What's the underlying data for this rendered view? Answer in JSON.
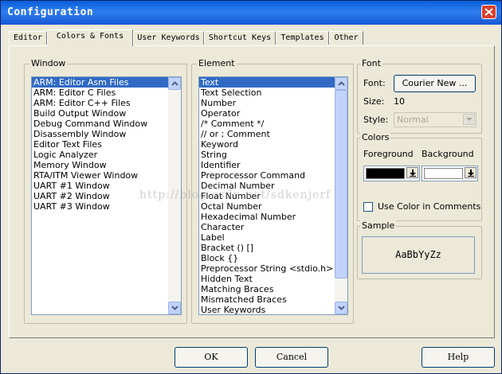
{
  "window": {
    "title": "Configuration"
  },
  "tabs": [
    {
      "label": "Editor",
      "active": false
    },
    {
      "label": "Colors & Fonts",
      "active": true
    },
    {
      "label": "User Keywords",
      "active": false
    },
    {
      "label": "Shortcut Keys",
      "active": false
    },
    {
      "label": "Templates",
      "active": false
    },
    {
      "label": "Other",
      "active": false
    }
  ],
  "window_group": {
    "label": "Window",
    "items": [
      "ARM: Editor Asm Files",
      "ARM: Editor C Files",
      "ARM: Editor C++ Files",
      "Build Output Window",
      "Debug Command Window",
      "Disassembly Window",
      "Editor Text Files",
      "Logic Analyzer",
      "Memory Window",
      "RTA/ITM Viewer Window",
      "UART #1 Window",
      "UART #2 Window",
      "UART #3 Window"
    ],
    "selected": "ARM: Editor Asm Files"
  },
  "element_group": {
    "label": "Element",
    "items": [
      "Text",
      "Text Selection",
      "Number",
      "Operator",
      "/* Comment */",
      "// or ; Comment",
      "Keyword",
      "String",
      "Identifier",
      "Preprocessor Command",
      "Decimal Number",
      "Float Number",
      "Octal Number",
      "Hexadecimal Number",
      "Character",
      "Label",
      "Bracket () []",
      "Block {}",
      "Preprocessor String <stdio.h>",
      "Hidden Text",
      "Matching Braces",
      "Mismatched Braces",
      "User Keywords"
    ],
    "selected": "Text"
  },
  "font_group": {
    "label": "Font",
    "font_label": "Font:",
    "font_button": "Courier New ...",
    "size_label": "Size:",
    "size_value": "10",
    "style_label": "Style:",
    "style_value": "Normal"
  },
  "colors_group": {
    "label": "Colors",
    "foreground_label": "Foreground",
    "background_label": "Background",
    "foreground_color": "#000000",
    "background_color": "#ffffff",
    "use_color_in_comments_label": "Use Color in Comments",
    "use_color_in_comments_checked": false
  },
  "sample_group": {
    "label": "Sample",
    "sample_text": "AaBbYyZz"
  },
  "buttons": {
    "ok": "OK",
    "cancel": "Cancel",
    "help": "Help"
  },
  "watermark": "http://blog.csdn.net/sdkenjerf"
}
